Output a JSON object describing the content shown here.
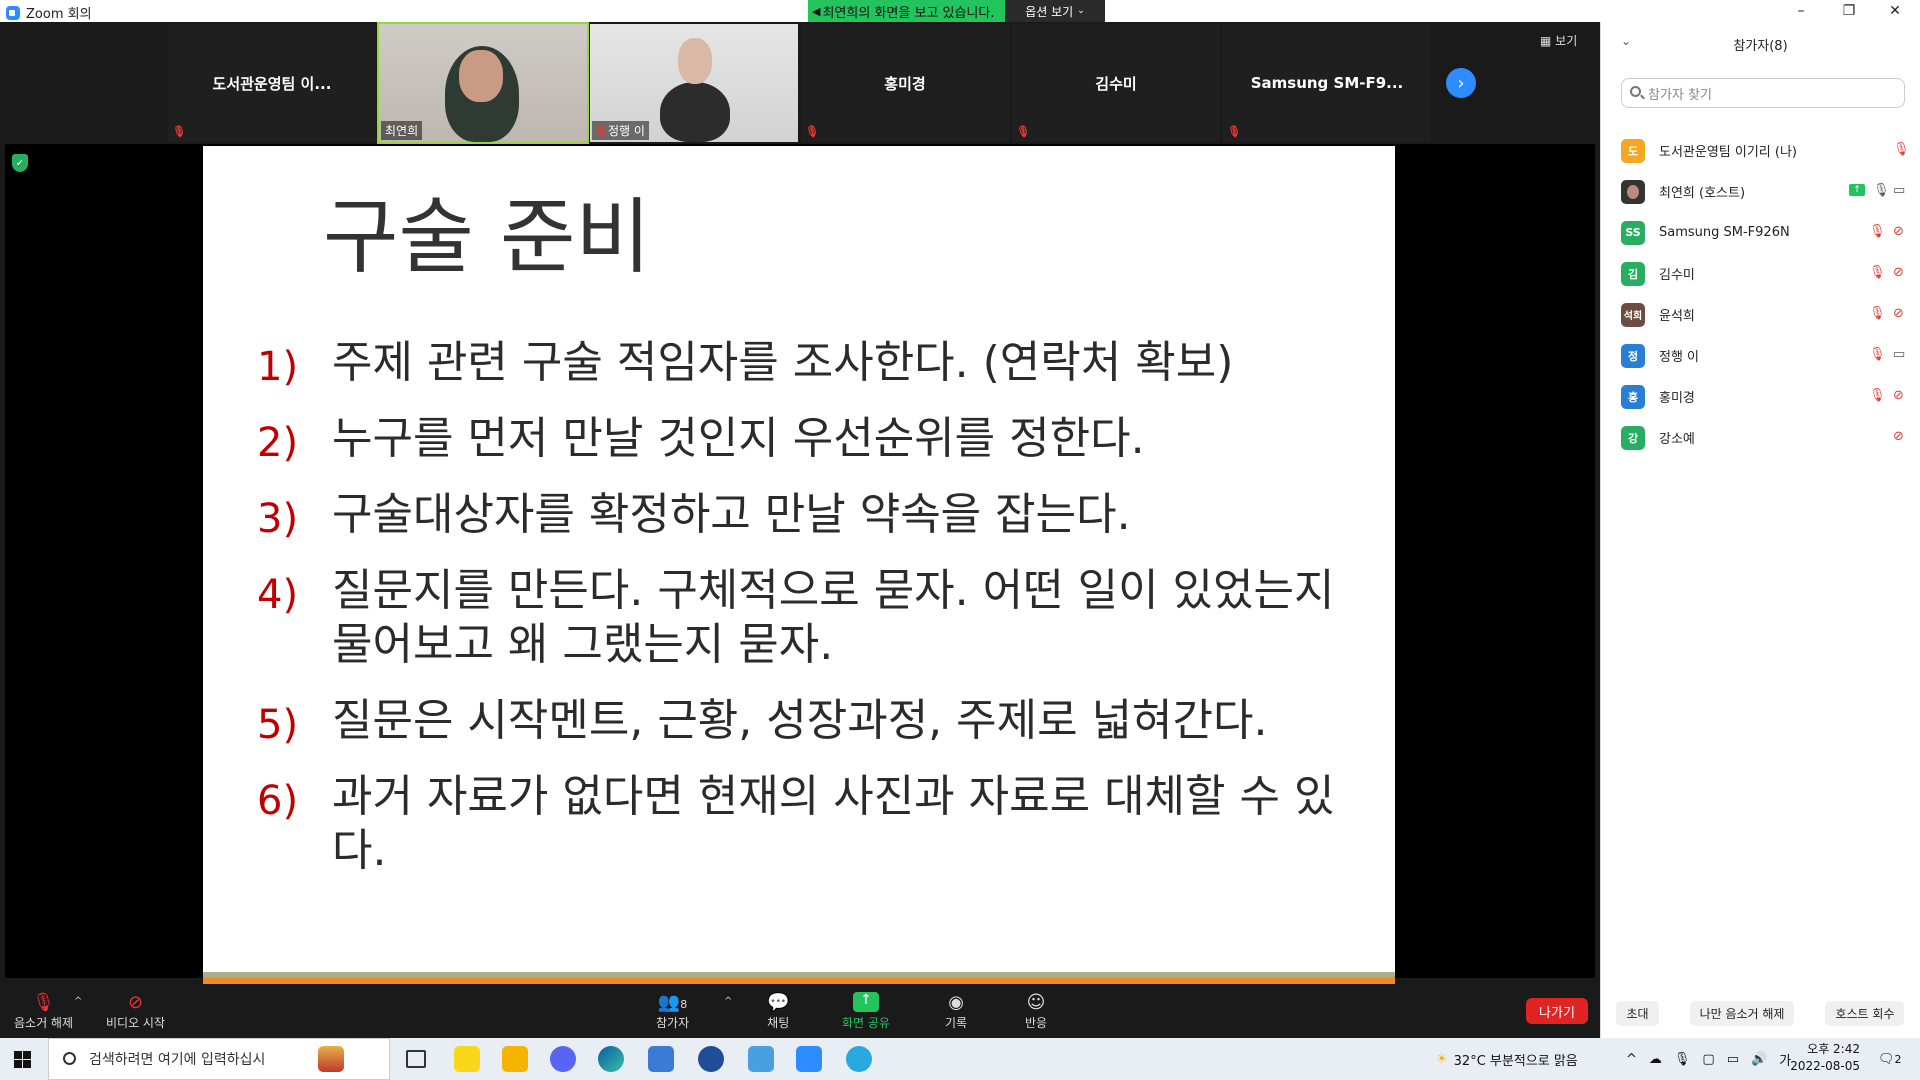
{
  "window": {
    "title": "Zoom 회의",
    "share_banner": "최연희의 화면을 보고 있습니다.",
    "options_label": "옵션 보기"
  },
  "gallery": {
    "tiles": [
      {
        "name": "도서관운영팀 이..."
      },
      {
        "name": "최연희"
      },
      {
        "name": "정행 이"
      },
      {
        "name": "홍미경"
      },
      {
        "name": "김수미"
      },
      {
        "name": "Samsung  SM-F9..."
      }
    ],
    "view_label": "보기"
  },
  "slide": {
    "title": "구술 준비",
    "items": [
      {
        "num": "1)",
        "text": "주제 관련 구술 적임자를 조사한다. (연락처 확보)"
      },
      {
        "num": "2)",
        "text": "누구를 먼저 만날 것인지 우선순위를 정한다."
      },
      {
        "num": "3)",
        "text": "구술대상자를 확정하고 만날 약속을 잡는다."
      },
      {
        "num": "4)",
        "text": "질문지를 만든다. 구체적으로 묻자. 어떤 일이 있었는지 물어보고 왜 그랬는지 묻자."
      },
      {
        "num": "5)",
        "text": "질문은 시작멘트, 근황, 성장과정, 주제로 넓혀간다."
      },
      {
        "num": "6)",
        "text": "과거 자료가 없다면 현재의 사진과 자료로 대체할 수 있다."
      }
    ]
  },
  "participants": {
    "header": "참가자(8)",
    "search_placeholder": "참가자 찾기",
    "list": [
      {
        "initials": "도",
        "name": "도서관운영팀 이기리 (나)",
        "color": "#f5a623"
      },
      {
        "initials": "",
        "name": "최연희 (호스트)",
        "color": "#333333"
      },
      {
        "initials": "SS",
        "name": "Samsung SM-F926N",
        "color": "#27ae60"
      },
      {
        "initials": "김",
        "name": "김수미",
        "color": "#27ae60"
      },
      {
        "initials": "석희",
        "name": "윤석희",
        "color": "#6d4c41"
      },
      {
        "initials": "정",
        "name": "정행 이",
        "color": "#2a7fd4"
      },
      {
        "initials": "홍",
        "name": "홍미경",
        "color": "#2a7fd4"
      },
      {
        "initials": "강",
        "name": "강소예",
        "color": "#27ae60"
      }
    ],
    "footer": {
      "invite": "초대",
      "unmute_me": "나만 음소거 해제",
      "reclaim_host": "호스트 회수"
    }
  },
  "toolbar": {
    "unmute": "음소거 해제",
    "start_video": "비디오 시작",
    "participants": "참가자",
    "participants_count": "8",
    "chat": "채팅",
    "share": "화면 공유",
    "record": "기록",
    "reactions": "반응",
    "leave": "나가기"
  },
  "taskbar": {
    "search_placeholder": "검색하려면 여기에 입력하십시",
    "weather": "32°C  부분적으로 맑음",
    "ime": "가",
    "time": "오후 2:42",
    "date": "2022-08-05",
    "notifications": "2"
  }
}
